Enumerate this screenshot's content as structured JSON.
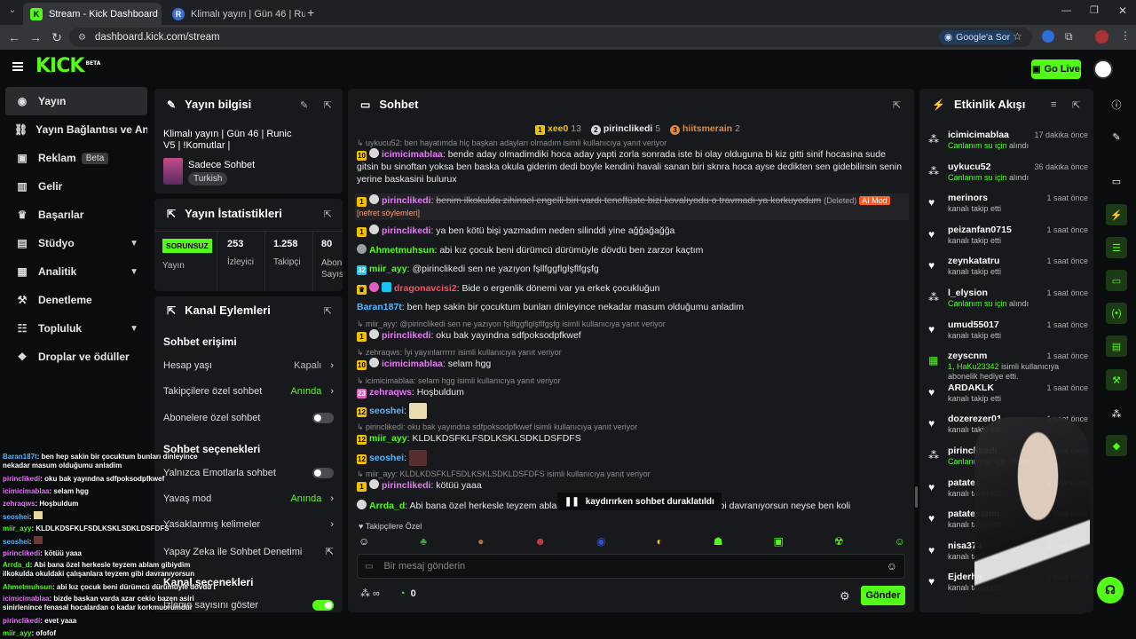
{
  "browser": {
    "tabs": [
      {
        "title": "Stream - Kick Dashboard",
        "active": true
      },
      {
        "title": "Klimalı yayın | Gün 46 | Runic V",
        "active": false
      }
    ],
    "url": "dashboard.kick.com/stream",
    "google_sor": "Google'a Sor"
  },
  "header": {
    "logo": "KICK",
    "logo_sup": "BETA",
    "go_live": "Go Live"
  },
  "sidebar": {
    "items": [
      {
        "label": "Yayın",
        "icon": "camera-icon",
        "active": true
      },
      {
        "label": "Yayın Bağlantısı ve Anahtar",
        "icon": "link-icon"
      },
      {
        "label": "Reklam",
        "icon": "ad-icon",
        "badge": "Beta"
      },
      {
        "label": "Gelir",
        "icon": "chart-icon"
      },
      {
        "label": "Başarılar",
        "icon": "trophy-icon"
      },
      {
        "label": "Stüdyo",
        "icon": "studio-icon",
        "chevron": true
      },
      {
        "label": "Analitik",
        "icon": "analytics-icon",
        "chevron": true
      },
      {
        "label": "Denetleme",
        "icon": "wrench-icon"
      },
      {
        "label": "Topluluk",
        "icon": "community-icon",
        "chevron": true
      },
      {
        "label": "Droplar ve ödüller",
        "icon": "drops-icon"
      }
    ]
  },
  "stream_info": {
    "title": "Yayın bilgisi",
    "stream_title": "Klimalı yayın | Gün 46 | Runic V5 | !Komutlar |",
    "category": "Sadece Sohbet",
    "language": "Turkish"
  },
  "stats": {
    "title": "Yayın İstatistikleri",
    "status": "SORUNSUZ",
    "status_label": "Yayın",
    "viewers": "253",
    "viewers_label": "İzleyici",
    "followers": "1.258",
    "followers_label": "Takipçi",
    "subs": "80",
    "subs_label": "Abone Sayısı"
  },
  "channel_actions": {
    "title": "Kanal Eylemleri",
    "chat_access": "Sohbet erişimi",
    "account_age": "Hesap yaşı",
    "account_age_value": "Kapalı",
    "followers_only": "Takipçilere özel sohbet",
    "followers_only_value": "Anında",
    "subs_only": "Abonelere özel sohbet",
    "chat_options": "Sohbet seçenekleri",
    "emote_only": "Yalnızca Emotlarla sohbet",
    "slow_mode": "Yavaş mod",
    "slow_mode_value": "Anında",
    "banned_words": "Yasaklanmış kelimeler",
    "ai_moderation": "Yapay Zeka ile Sohbet Denetimi",
    "channel_options": "Kanal seçenekleri",
    "viewer_count": "İzleme sayısını göster"
  },
  "chat": {
    "title": "Sohbet",
    "leaders": [
      {
        "rank": "1",
        "name": "xee0",
        "count": "13"
      },
      {
        "rank": "2",
        "name": "pirinclikedi",
        "count": "5"
      },
      {
        "rank": "3",
        "name": "hiitsmerain",
        "count": "2"
      }
    ],
    "messages": [
      {
        "reply": "uykucu52: ben hayatımda hiç başkan adayları olmadım isimli kullanıcıya yanıt veriyor",
        "badge": "10",
        "user": "icimicimablaa",
        "color": "#e878f8",
        "text": "bende aday olmadimdiki hoca aday yapti zorla sonrada iste bi olay olduguna bi kiz gitti sinif hocasina sude gitsin bu sinoftan yoksa ben baska okula giderim dedi boyle kendini havali sanan biri sknra hoca ayse dedikten sen gidebilirsin senin yerine baskasini bulurux"
      },
      {
        "badge": "1",
        "user": "pirinclikedi",
        "color": "#e878f8",
        "text": "benim ilkokulda zihinsel engelli biri vardı teneffüste bizi kovalıyodu o travmadı ya korkuyodum",
        "deleted": "(Deleted)",
        "tag": "AI Mod",
        "tail": "[nefret söylemleri]"
      },
      {
        "badge": "1",
        "user": "pirinclikedi",
        "color": "#e878f8",
        "text": "ya ben kötü bişi yazmadım neden silinddi yine ağğağağğa"
      },
      {
        "badge": "",
        "user": "Ahmetmuhsun",
        "color": "#53fc18",
        "text": "abi kız çocuk beni dürümcü dürümüyle dövdü ben zarzor kaçtım"
      },
      {
        "badge": "32",
        "user": "miir_ayy",
        "color": "#53fc18",
        "text": "@pirinclikedi sen ne yazıyon fşllfggflglşflfgşfg"
      },
      {
        "badge": "",
        "user": "dragonavcisi2",
        "color": "#ff4d6a",
        "text": "Bide o ergenlik dönemi var ya erkek çocukluğun"
      },
      {
        "badge": "",
        "user": "Baran187t",
        "color": "#55b8ff",
        "text": "ben hep sakin bir çocuktum bunları dinleyince nekadar masum olduğumu anladim"
      },
      {
        "reply": "miir_ayy: @pirinclikedi sen ne yazıyon fşllfggflglşflfgşfg isimli kullanıcıya yanıt veriyor",
        "badge": "1",
        "user": "pirinclikedi",
        "color": "#e878f8",
        "text": "oku bak yayındna sdfpoksodpfkwef"
      },
      {
        "reply": "zehraqws: İyi yayınlarrrrrr isimli kullanıcıya yanıt veriyor",
        "badge": "10",
        "user": "icimicimablaa",
        "color": "#e878f8",
        "text": "selam hgg"
      },
      {
        "reply": "icimicimablaa: selam hgg isimli kullanıcıya yanıt veriyor",
        "badge": "23",
        "user": "zehraqws",
        "color": "#e878f8",
        "text": "Hoşbuldum"
      },
      {
        "badge": "12",
        "user": "seoshei",
        "color": "#55b8ff",
        "text": ""
      },
      {
        "reply": "pirinclikedi: oku bak yayındna sdfpoksodpfkwef isimli kullanıcıya yanıt veriyor",
        "badge": "12",
        "user": "miir_ayy",
        "color": "#53fc18",
        "text": "KLDLKDSFKLFSDLKSKLSDKLDSFDFS"
      },
      {
        "badge": "12",
        "user": "seoshei",
        "color": "#55b8ff",
        "text": ""
      },
      {
        "reply": "miir_ayy: KLDLKDSFKLFSDLKSKLSDKLDSFDFS isimli kullanıcıya yanıt veriyor",
        "badge": "1",
        "user": "pirinclikedi",
        "color": "#e878f8",
        "text": "kötüü yaaa"
      },
      {
        "badge": "",
        "user": "Arrda_d",
        "color": "#53fc18",
        "text": "Abi bana özel herkesle teyzem ablam gibiydim ilkokulda okuldaki teyzem gibi davranıyorsun neyse ben koli"
      }
    ],
    "paused": "kaydırırken sohbet duraklatıldı",
    "followers_only": "Takipçilere Özel",
    "placeholder": "Bir mesaj gönderin",
    "points": "0",
    "send": "Gönder"
  },
  "activity": {
    "title": "Etkinlik Akışı",
    "items": [
      {
        "name": "icimicimablaa",
        "time": "17 dakika önce",
        "desc": "Canlanım su için",
        "desc2": "alındı",
        "green": true,
        "icon": "drops-icon"
      },
      {
        "name": "uykucu52",
        "time": "36 dakika önce",
        "desc": "Canlanım su için",
        "desc2": "alındı",
        "green": true,
        "icon": "drops-icon"
      },
      {
        "name": "merinors",
        "time": "1 saat önce",
        "desc": "kanalı takip etti",
        "icon": "heart-icon"
      },
      {
        "name": "peizanfan0715",
        "time": "1 saat önce",
        "desc": "kanalı takip etti",
        "icon": "heart-icon"
      },
      {
        "name": "zeynkatatru",
        "time": "1 saat önce",
        "desc": "kanalı takip etti",
        "icon": "heart-icon"
      },
      {
        "name": "l_elysion",
        "time": "1 saat önce",
        "desc": "Canlanım su için",
        "desc2": "alındı",
        "green": true,
        "icon": "drops-icon"
      },
      {
        "name": "umud55017",
        "time": "1 saat önce",
        "desc": "kanalı takip etti",
        "icon": "heart-icon"
      },
      {
        "name": "zeyscnm",
        "time": "1 saat önce",
        "desc": "1, HaKu23342",
        "desc2": "isimli kullanıcıya abonelik hediye etti.",
        "green": true,
        "icon": "gift-icon"
      },
      {
        "name": "ARDAKLK",
        "time": "1 saat önce",
        "desc": "kanalı takip etti",
        "icon": "heart-icon"
      },
      {
        "name": "dozerezer01",
        "time": "1 saat önce",
        "desc": "kanalı takip etti",
        "icon": "heart-icon"
      },
      {
        "name": "pirinclikedi",
        "time": "1 saat önce",
        "desc": "Canlanım su için",
        "desc2": "alındı",
        "green": true,
        "icon": "drops-icon"
      },
      {
        "name": "patates",
        "time": "1 saat önce",
        "desc": "kanalı takip etti",
        "icon": "heart-icon"
      },
      {
        "name": "patatesahm",
        "time": "1 saat önce",
        "desc": "kanalı takip etti",
        "icon": "heart-icon"
      },
      {
        "name": "nisa373",
        "time": "1 saat önce",
        "desc": "kanalı takip etti",
        "icon": "heart-icon"
      },
      {
        "name": "Ejderha",
        "time": "1 saat önce",
        "desc": "kanalı takip etti",
        "icon": "heart-icon"
      }
    ]
  },
  "overlay": {
    "lines": [
      {
        "user": "Baran187t",
        "text": "ben hep sakin bir çocuktum bunları dinleyince nekadar masum olduğumu anladim"
      },
      {
        "user": "pirinclikedi",
        "text": "oku bak yayındna sdfpoksodpfkwef"
      },
      {
        "user": "icimicimablaa",
        "text": "selam hgg"
      },
      {
        "user": "zehraqws",
        "text": "Hoşbuldum"
      },
      {
        "user": "seoshei",
        "text": ""
      },
      {
        "user": "miir_ayy",
        "text": "KLDLKDSFKLFSDLKSKLSDKLDSFDFS"
      },
      {
        "user": "seoshei",
        "text": ""
      },
      {
        "user": "pirinclikedi",
        "text": "kötüü yaaa"
      },
      {
        "user": "Arrda_d",
        "text": "Abi bana özel herkesle teyzem ablam gibiydim ilkokulda okuldaki çalışanlara teyzem gibi davranıyorsun neyse ben koli bantlıcam pazartesi için"
      },
      {
        "user": "Ahmetmuhsun",
        "text": "abi kız çocuk beni dürümcü dürümüyle dövdü ben zarzor kaçtım"
      },
      {
        "user": "icimicimablaa",
        "text": "bizde baskan varda azar cekio bazen asiri sinirlenince fenasal hocalardan o kadar korkmuorumdur"
      },
      {
        "user": "pirinclikedi",
        "text": "evet yaaa"
      },
      {
        "user": "miir_ayy",
        "text": "ofofof"
      }
    ]
  },
  "colors": {
    "accent": "#53fc18",
    "panel": "#18191c",
    "bg": "#0b0c0e"
  }
}
